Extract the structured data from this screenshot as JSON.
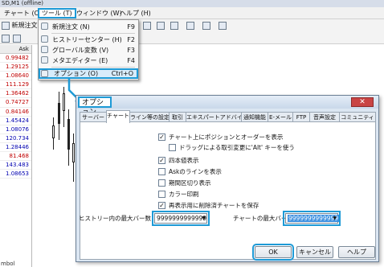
{
  "app": {
    "title": "SD,M1 (offline)"
  },
  "menubar": {
    "items": [
      "チャート (C)",
      "ツール (T)",
      "ウィンドウ (W)",
      "ヘルプ (H)"
    ]
  },
  "toolbar": {
    "new_order": "新規注文"
  },
  "tools_menu": {
    "items": [
      {
        "label": "新規注文 (N)",
        "shortcut": "F9",
        "icon": "new-order-icon"
      },
      {
        "label": "ヒストリーセンター (H)",
        "shortcut": "F2",
        "icon": "history-center-icon"
      },
      {
        "label": "グローバル変数 (V)",
        "shortcut": "F3",
        "icon": "global-variables-icon"
      },
      {
        "label": "メタエディター (E)",
        "shortcut": "F4",
        "icon": "metaeditor-icon"
      },
      {
        "label": "オプション (O)",
        "shortcut": "Ctrl+O",
        "icon": "options-icon"
      }
    ]
  },
  "market_watch": {
    "header": "Ask",
    "rows": [
      {
        "value": "0.99482",
        "color": "red"
      },
      {
        "value": "1.29125",
        "color": "red"
      },
      {
        "value": "1.08640",
        "color": "red"
      },
      {
        "value": "111.129",
        "color": "red"
      },
      {
        "value": "1.36462",
        "color": "red"
      },
      {
        "value": "0.74727",
        "color": "red"
      },
      {
        "value": "0.84146",
        "color": "red"
      },
      {
        "value": "1.45424",
        "color": "blue"
      },
      {
        "value": "1.08076",
        "color": "blue"
      },
      {
        "value": "120.734",
        "color": "blue"
      },
      {
        "value": "1.28446",
        "color": "blue"
      },
      {
        "value": "81.468",
        "color": "red"
      },
      {
        "value": "143.483",
        "color": "blue"
      },
      {
        "value": "1.08653",
        "color": "blue"
      }
    ],
    "footer": "mbol"
  },
  "options_dialog": {
    "title": "オプション",
    "close": "✕",
    "tabs": [
      "サーバー",
      "チャート",
      "ライン等の設定",
      "取引",
      "エキスパートアドバイザ",
      "通知機能",
      "E-メール",
      "FTP",
      "音声設定",
      "コミュニティ"
    ],
    "active_tab": "チャート",
    "checkboxes": [
      {
        "label": "チャート上にポジションとオーダーを表示",
        "checked": true
      },
      {
        "label": "ドラッグによる取引変更に'Alt' キーを使う",
        "checked": false
      },
      {
        "label": "四本値表示",
        "checked": true
      },
      {
        "label": "Askのラインを表示",
        "checked": false
      },
      {
        "label": "期間区切り表示",
        "checked": false
      },
      {
        "label": "カラー印刷",
        "checked": false
      },
      {
        "label": "再表示用に削除済チャートを保存",
        "checked": true
      }
    ],
    "check_mark": "✓",
    "history_max_bars_label": "ヒストリー内の最大バー数",
    "history_max_bars_value": "9999999999999",
    "chart_max_bars_label": "チャートの最大バー数",
    "chart_max_bars_value": "9999999999999",
    "buttons": {
      "ok": "OK",
      "cancel": "キャンセル",
      "help": "ヘルプ"
    }
  },
  "colors": {
    "highlight": "#1e9ad6",
    "ask_up": "#c00000",
    "ask_down": "#0000b0"
  }
}
